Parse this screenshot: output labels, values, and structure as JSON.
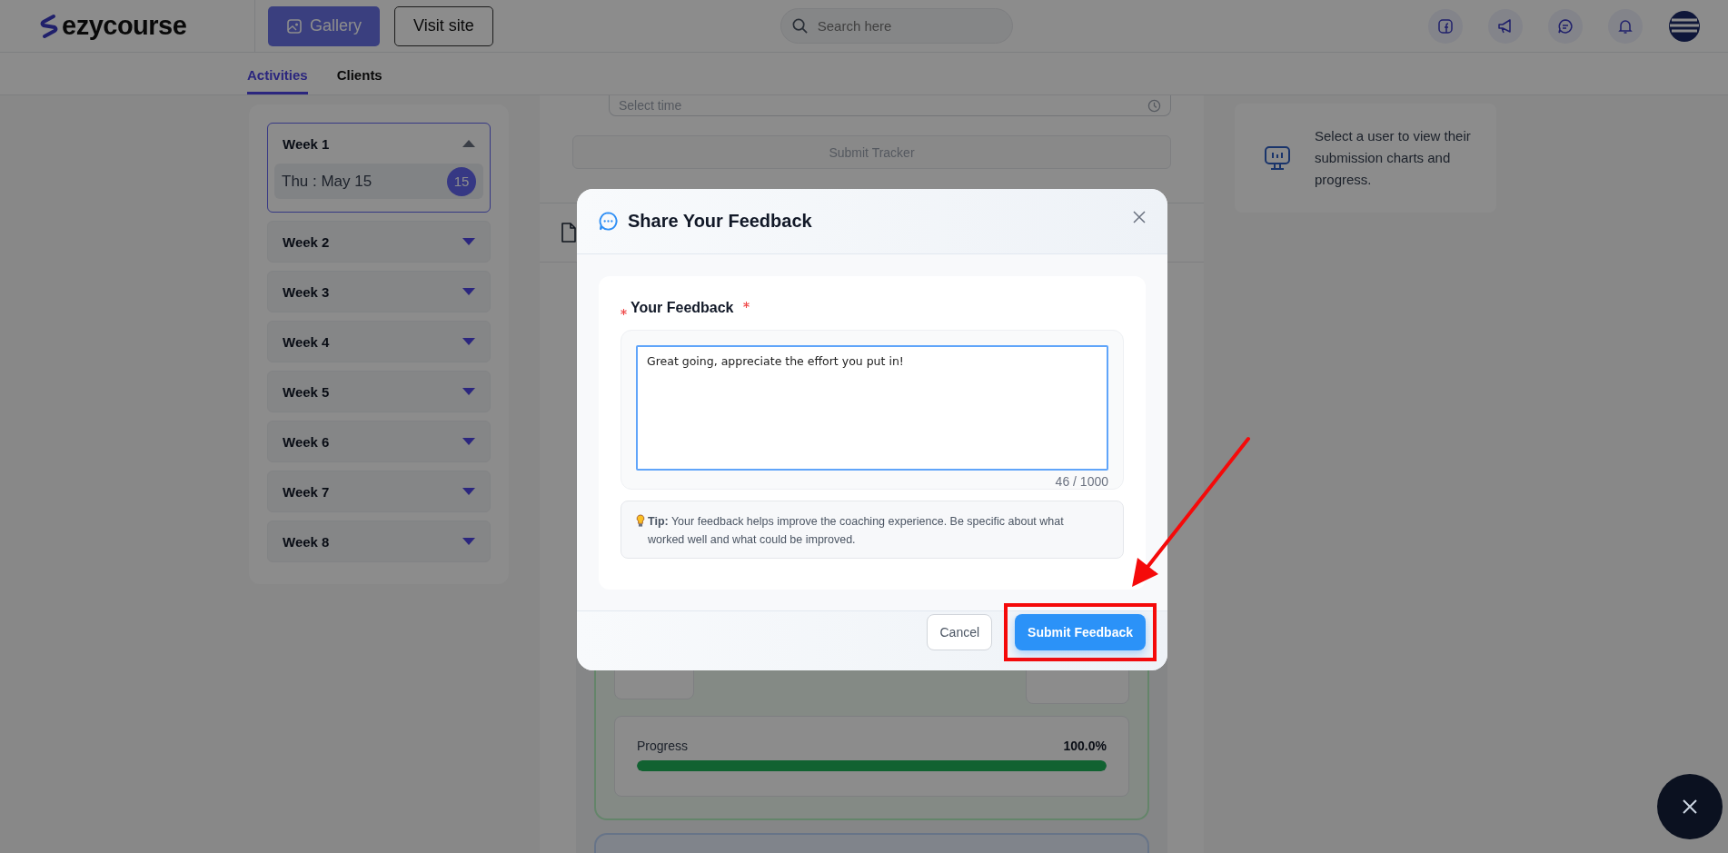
{
  "header": {
    "logo": "ezycourse",
    "buttons": [
      {
        "label": "Gallery",
        "kind": "primary"
      },
      {
        "label": "Visit site",
        "kind": "outline"
      }
    ],
    "search": {
      "placeholder": "Search here"
    }
  },
  "tabs": [
    {
      "label": "Activities",
      "selected": true
    },
    {
      "label": "Clients",
      "selected": false
    }
  ],
  "weeks": [
    {
      "label": "Week 1",
      "expanded": true,
      "days": [
        {
          "label": "Thu : May 15",
          "badge": "15"
        }
      ]
    },
    {
      "label": "Week 2",
      "expanded": false
    },
    {
      "label": "Week 3",
      "expanded": false
    },
    {
      "label": "Week 4",
      "expanded": false
    },
    {
      "label": "Week 5",
      "expanded": false
    },
    {
      "label": "Week 6",
      "expanded": false
    },
    {
      "label": "Week 7",
      "expanded": false
    },
    {
      "label": "Week 8",
      "expanded": false
    }
  ],
  "tracker": {
    "time_placeholder": "Select time",
    "submit": "Submit Tracker"
  },
  "progress": {
    "label": "Progress",
    "value": "100.0%",
    "level": 1
  },
  "info_card": {
    "text": "Select a user to view their submission charts and progress."
  },
  "modal": {
    "title": "Share Your Feedback",
    "field_label": "Your Feedback",
    "required": true,
    "value": "Great going, appreciate the effort you put in!",
    "counter": "46 / 1000",
    "tip": "**Tip:** Your feedback helps improve the coaching experience. Be specific about what worked well and what could be improved.",
    "buttons": [
      {
        "label": "Cancel",
        "kind": "secondary",
        "highlighted": false
      },
      {
        "label": "Submit Feedback",
        "kind": "primary",
        "highlighted": true
      }
    ]
  }
}
